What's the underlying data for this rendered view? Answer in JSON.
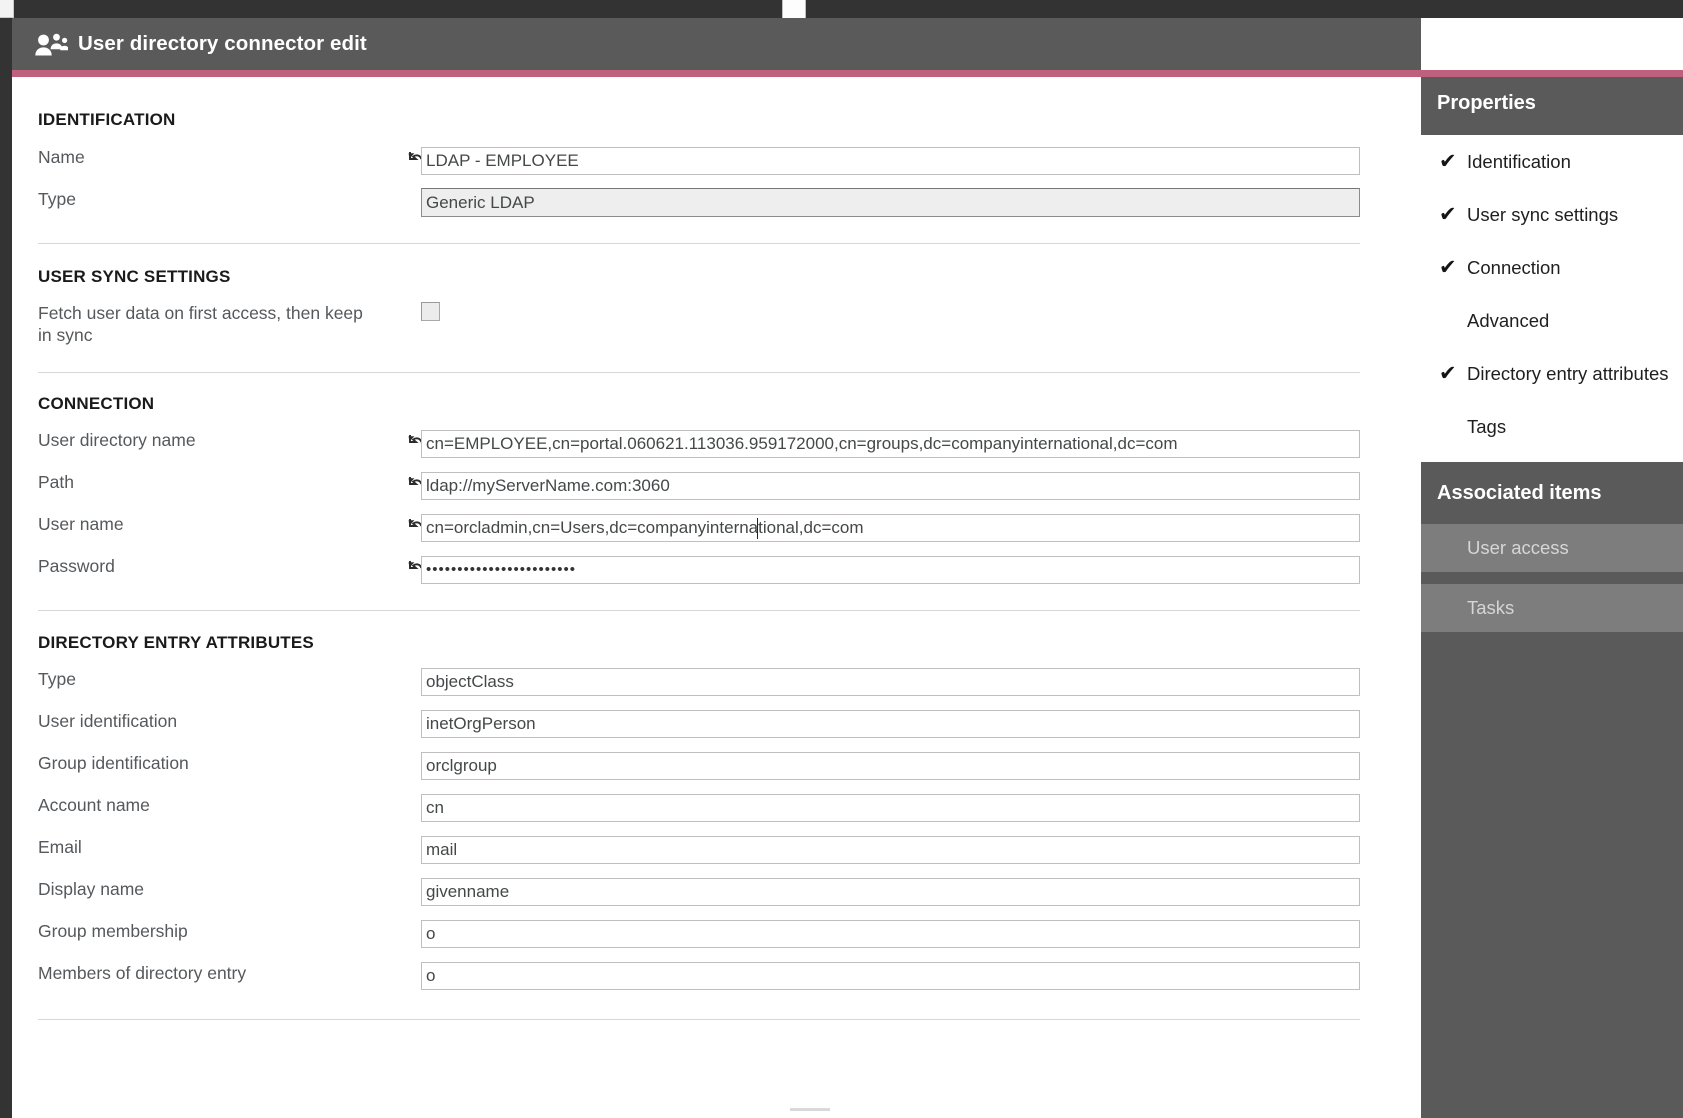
{
  "window": {
    "title": "User directory connector edit",
    "title_icon": "people-group-icon",
    "accent_color": "#c0607f",
    "header_bg": "#5a5a5a"
  },
  "sections": {
    "identification": {
      "heading": "IDENTIFICATION",
      "fields": [
        {
          "label": "Name",
          "value": "LDAP - EMPLOYEE",
          "has_undo": true,
          "kind": "text"
        },
        {
          "label": "Type",
          "value": "Generic LDAP",
          "has_undo": false,
          "kind": "select"
        }
      ]
    },
    "user_sync": {
      "heading": "USER SYNC SETTINGS",
      "fields": [
        {
          "label": "Fetch user data on first access, then keep in sync",
          "value": "",
          "kind": "checkbox",
          "checked": false
        }
      ]
    },
    "connection": {
      "heading": "CONNECTION",
      "fields": [
        {
          "label": "User directory name",
          "value": "cn=EMPLOYEE,cn=portal.060621.113036.959172000,cn=groups,dc=companyinternational,dc=com",
          "has_undo": true,
          "kind": "text"
        },
        {
          "label": "Path",
          "value": "ldap://myServerName.com:3060",
          "has_undo": true,
          "kind": "text"
        },
        {
          "label": "User name",
          "value": "cn=orcladmin,cn=Users,dc=companyinternational,dc=com",
          "has_undo": true,
          "kind": "text"
        },
        {
          "label": "Password",
          "value": "••••••••••••••••••••••••",
          "has_undo": true,
          "kind": "password"
        }
      ]
    },
    "directory_entry_attributes": {
      "heading": "DIRECTORY ENTRY ATTRIBUTES",
      "fields": [
        {
          "label": "Type",
          "value": "objectClass",
          "has_undo": false,
          "kind": "text"
        },
        {
          "label": "User identification",
          "value": "inetOrgPerson",
          "has_undo": false,
          "kind": "text"
        },
        {
          "label": "Group identification",
          "value": "orclgroup",
          "has_undo": false,
          "kind": "text"
        },
        {
          "label": "Account name",
          "value": "cn",
          "has_undo": false,
          "kind": "text"
        },
        {
          "label": "Email",
          "value": "mail",
          "has_undo": false,
          "kind": "text"
        },
        {
          "label": "Display name",
          "value": "givenname",
          "has_undo": false,
          "kind": "text"
        },
        {
          "label": "Group membership",
          "value": "o",
          "has_undo": false,
          "kind": "text"
        },
        {
          "label": "Members of directory entry",
          "value": "o",
          "has_undo": false,
          "kind": "text"
        }
      ]
    }
  },
  "properties_panel": {
    "title": "Properties",
    "items": [
      {
        "label": "Identification",
        "checked": true
      },
      {
        "label": "User sync settings",
        "checked": true
      },
      {
        "label": "Connection",
        "checked": true
      },
      {
        "label": "Advanced",
        "checked": false
      },
      {
        "label": "Directory entry attributes",
        "checked": true
      },
      {
        "label": "Tags",
        "checked": false
      }
    ],
    "check_glyph": "✔"
  },
  "associated_panel": {
    "title": "Associated items",
    "items": [
      {
        "label": "User access"
      },
      {
        "label": "Tasks"
      }
    ]
  }
}
